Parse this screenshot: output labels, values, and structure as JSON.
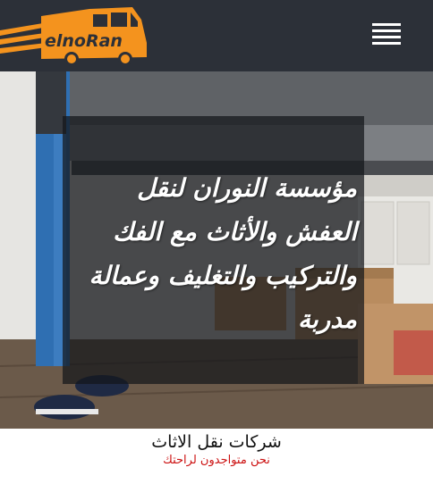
{
  "header": {
    "logo_text": "elnoRan",
    "menu_icon": "hamburger-icon"
  },
  "hero": {
    "caption": "مؤسسة النوران لنقل العفش والأثاث مع الفك والتركيب والتغليف وعمالة مدربة"
  },
  "section": {
    "title": "شركات نقل الاثاث",
    "subtitle": "نحن متواجدون لراحتك"
  },
  "colors": {
    "header_bg": "#2c3038",
    "logo_orange": "#f4931e",
    "subtitle_red": "#cc1111"
  }
}
